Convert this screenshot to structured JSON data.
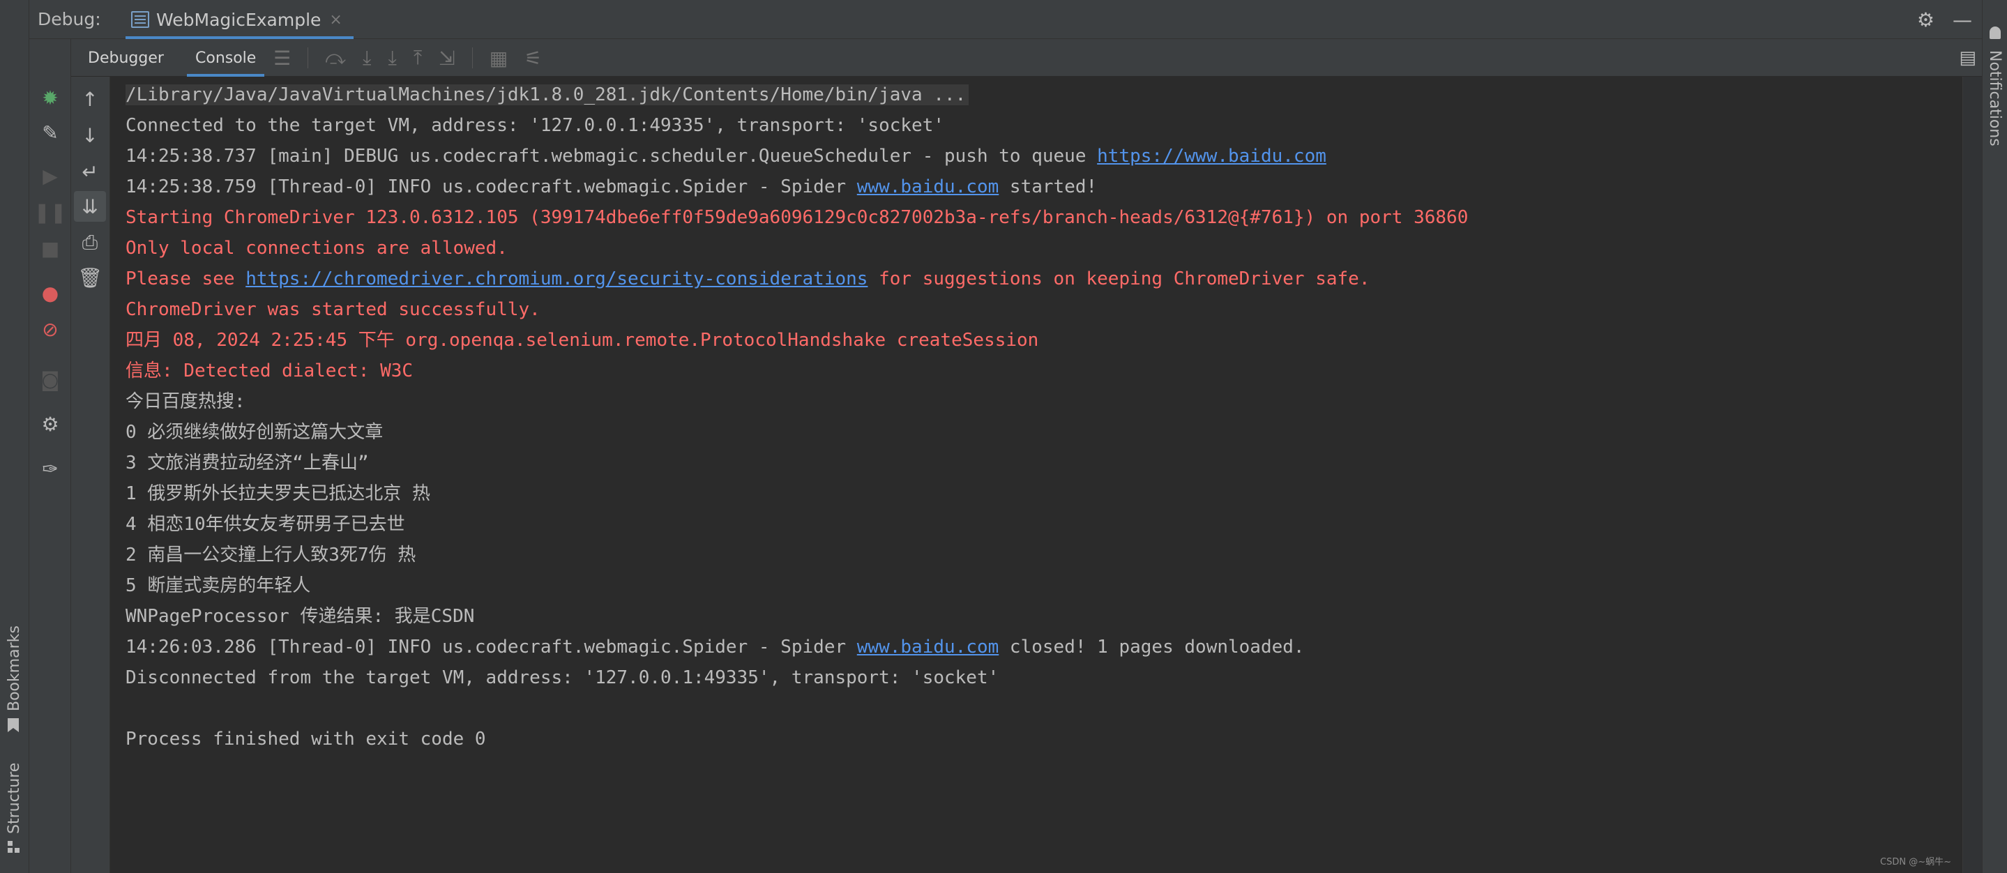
{
  "titlebar": {
    "debug_label": "Debug:",
    "tab_label": "WebMagicExample",
    "tab_close": "×"
  },
  "toolbar": {
    "debugger_tab": "Debugger",
    "console_tab": "Console"
  },
  "strips": {
    "bookmarks": "Bookmarks",
    "structure": "Structure",
    "notifications": "Notifications"
  },
  "console": {
    "lines": [
      [
        {
          "t": "/Library/Java/JavaVirtualMachines/jdk1.8.0_281.jdk/Contents/Home/bin/java ...",
          "c": "cmd"
        }
      ],
      [
        {
          "t": "Connected to the target VM, address: '127.0.0.1:49335', transport: 'socket'",
          "c": "default"
        }
      ],
      [
        {
          "t": "14:25:38.737 [main] DEBUG us.codecraft.webmagic.scheduler.QueueScheduler - push to queue ",
          "c": "default"
        },
        {
          "t": "https://www.baidu.com",
          "c": "link"
        }
      ],
      [
        {
          "t": "14:25:38.759 [Thread-0] INFO us.codecraft.webmagic.Spider - Spider ",
          "c": "default"
        },
        {
          "t": "www.baidu.com",
          "c": "link"
        },
        {
          "t": " started!",
          "c": "default"
        }
      ],
      [
        {
          "t": "Starting ChromeDriver 123.0.6312.105 (399174dbe6eff0f59de9a6096129c0c827002b3a-refs/branch-heads/6312@{#761}) on port 36860",
          "c": "error"
        }
      ],
      [
        {
          "t": "Only local connections are allowed.",
          "c": "error"
        }
      ],
      [
        {
          "t": "Please see ",
          "c": "error"
        },
        {
          "t": "https://chromedriver.chromium.org/security-considerations",
          "c": "link"
        },
        {
          "t": " for suggestions on keeping ChromeDriver safe.",
          "c": "error"
        }
      ],
      [
        {
          "t": "ChromeDriver was started successfully.",
          "c": "error"
        }
      ],
      [
        {
          "t": "四月 08, 2024 2:25:45 下午 org.openqa.selenium.remote.ProtocolHandshake createSession",
          "c": "error"
        }
      ],
      [
        {
          "t": "信息: Detected dialect: W3C",
          "c": "error"
        }
      ],
      [
        {
          "t": "今日百度热搜:",
          "c": "default"
        }
      ],
      [
        {
          "t": "0 必须继续做好创新这篇大文章",
          "c": "default"
        }
      ],
      [
        {
          "t": "3 文旅消费拉动经济“上春山”",
          "c": "default"
        }
      ],
      [
        {
          "t": "1 俄罗斯外长拉夫罗夫已抵达北京 热",
          "c": "default"
        }
      ],
      [
        {
          "t": "4 相恋10年供女友考研男子已去世",
          "c": "default"
        }
      ],
      [
        {
          "t": "2 南昌一公交撞上行人致3死7伤 热",
          "c": "default"
        }
      ],
      [
        {
          "t": "5 断崖式卖房的年轻人",
          "c": "default"
        }
      ],
      [
        {
          "t": "WNPageProcessor 传递结果: 我是CSDN",
          "c": "default"
        }
      ],
      [
        {
          "t": "14:26:03.286 [Thread-0] INFO us.codecraft.webmagic.Spider - Spider ",
          "c": "default"
        },
        {
          "t": "www.baidu.com",
          "c": "link"
        },
        {
          "t": " closed! 1 pages downloaded.",
          "c": "default"
        }
      ],
      [
        {
          "t": "Disconnected from the target VM, address: '127.0.0.1:49335', transport: 'socket'",
          "c": "default"
        }
      ],
      [
        {
          "t": "",
          "c": "default"
        }
      ],
      [
        {
          "t": "Process finished with exit code 0",
          "c": "default"
        }
      ]
    ]
  },
  "watermark": "CSDN @~蜗牛~",
  "colors": {
    "accent": "#4a88c7",
    "error_text": "#ff6b68",
    "link_text": "#5394ec",
    "default_text": "#bbbbbb",
    "bug_icon": "#59a869",
    "breakpoint_icon": "#db5c5c"
  }
}
